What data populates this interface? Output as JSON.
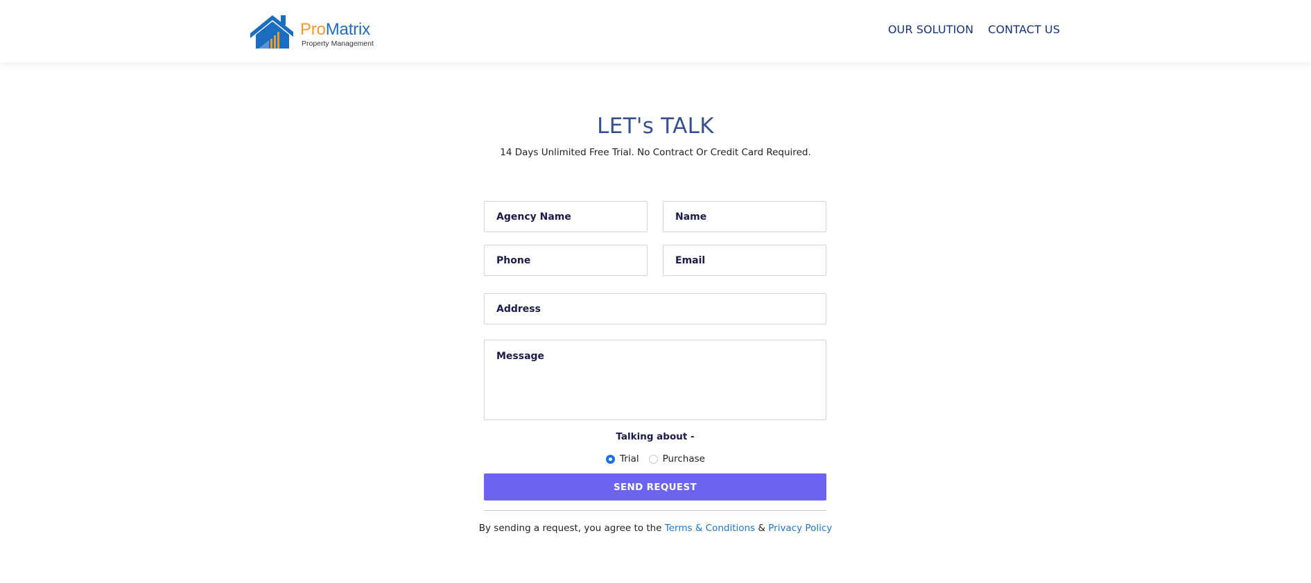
{
  "header": {
    "logo": {
      "brand_pro": "Pro",
      "brand_matrix": "Matrix",
      "tagline": "Property Management"
    },
    "nav": [
      {
        "label": "OUR SOLUTION"
      },
      {
        "label": "CONTACT US"
      }
    ]
  },
  "main": {
    "title": "LET's TALK",
    "subtitle": "14 Days Unlimited Free Trial. No Contract Or Credit Card Required."
  },
  "form": {
    "agency_name": {
      "placeholder": "Agency Name",
      "value": ""
    },
    "name": {
      "placeholder": "Name",
      "value": ""
    },
    "phone": {
      "placeholder": "Phone",
      "value": ""
    },
    "email": {
      "placeholder": "Email",
      "value": ""
    },
    "address": {
      "placeholder": "Address",
      "value": ""
    },
    "message": {
      "placeholder": "Message",
      "value": ""
    },
    "talking_about": {
      "label": "Talking about -",
      "options": [
        {
          "label": "Trial",
          "checked": true
        },
        {
          "label": "Purchase",
          "checked": false
        }
      ]
    },
    "submit_label": "SEND REQUEST",
    "agreement": {
      "prefix": "By sending a request, you agree to the",
      "terms_link": "Terms & Conditions",
      "conjunction": "&",
      "privacy_link": "Privacy Policy"
    }
  },
  "colors": {
    "brand_orange": "#f09a2a",
    "brand_blue": "#1b6dc1",
    "nav_text": "#17327a",
    "title": "#37508f",
    "button": "#6c63f0",
    "link": "#1f74c7",
    "radio_checked": "#1a6ee6"
  }
}
